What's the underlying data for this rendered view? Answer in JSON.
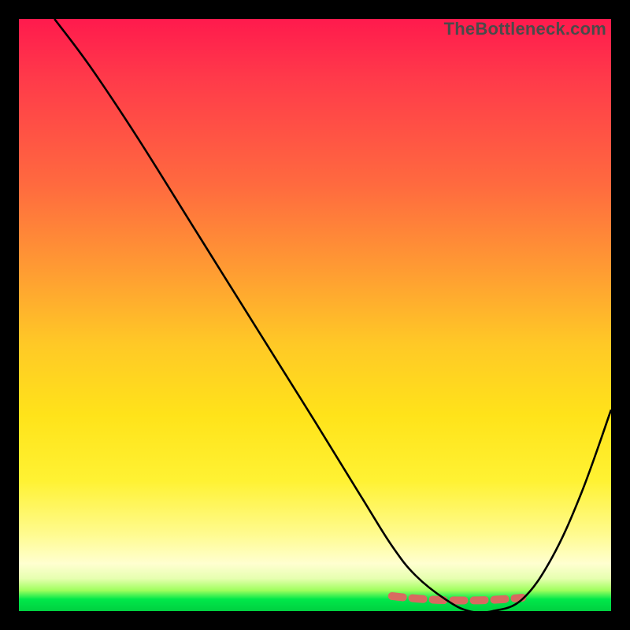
{
  "watermark": "TheBottleneck.com",
  "chart_data": {
    "type": "line",
    "title": "",
    "xlabel": "",
    "ylabel": "",
    "xlim": [
      0,
      100
    ],
    "ylim": [
      0,
      100
    ],
    "grid": false,
    "legend": false,
    "series": [
      {
        "name": "bottleneck-curve",
        "x": [
          6,
          12,
          20,
          30,
          40,
          50,
          58,
          63,
          67,
          72,
          76,
          80,
          85,
          90,
          95,
          100
        ],
        "y": [
          100,
          92,
          80,
          64,
          48,
          32,
          19,
          11,
          6,
          2,
          0,
          0,
          2,
          9,
          20,
          34
        ],
        "color": "#000000"
      }
    ],
    "annotations": [
      {
        "name": "optimal-range-marker",
        "type": "dashed-segment",
        "x_start": 63,
        "x_end": 85,
        "y": 2,
        "color": "#d86a60"
      }
    ],
    "background_gradient": {
      "direction": "vertical",
      "stops": [
        {
          "pos": 0.0,
          "color": "#ff1a4d"
        },
        {
          "pos": 0.42,
          "color": "#ff9a33"
        },
        {
          "pos": 0.78,
          "color": "#fff233"
        },
        {
          "pos": 0.92,
          "color": "#ffffd0"
        },
        {
          "pos": 1.0,
          "color": "#00d040"
        }
      ]
    }
  }
}
